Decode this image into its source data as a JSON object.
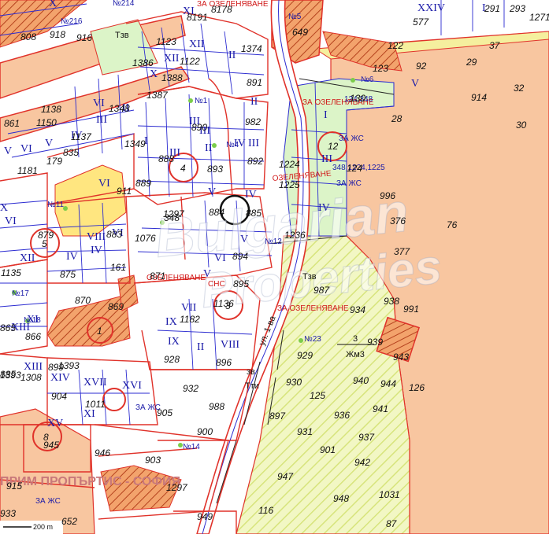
{
  "colors": {
    "orange": "#f8c6a0",
    "orange_dark": "#f3a36c",
    "green": "#dcf4c8",
    "yellow": "#ffe680",
    "road_yellow": "#f5ef9e",
    "parcel_red": "#e0322a",
    "inner_blue": "#2b2bd0",
    "hatch": "#c65a2c"
  },
  "scale_label": "200 m",
  "watermark_top": "Bulgarian",
  "watermark_bottom": "Properties",
  "company_text": "ПРИМ ПРОПЪРТИС - СОФИЯ",
  "zone_labels": [
    {
      "t": "Тзв"
    },
    {
      "t": "Тзв"
    },
    {
      "t": "зв"
    },
    {
      "t": "Тти"
    }
  ],
  "zoning_box": {
    "top": "3",
    "bottom": "Жм3"
  },
  "street_name": "ул. 1-ва",
  "red_notes": [
    {
      "t": "ЗА ОЗЕЛЕНЯВАНЕ"
    },
    {
      "t": "ОЗЕЛЕНЯВАНЕ"
    },
    {
      "t": "ОЗЕЛЕНЯВАНЕ"
    },
    {
      "t": "ЗА ОЗЕЛЕНЯВАНЕ"
    },
    {
      "t": "ЗА ОЗЕЛЕНЯВАНЕ"
    },
    {
      "t": "СНС"
    }
  ],
  "blue_notes": [
    {
      "t": "ЗА ЖС"
    },
    {
      "t": "ЗА ЖС"
    },
    {
      "t": "ЗА ЖС"
    },
    {
      "t": "ЗА ЖС"
    },
    {
      "t": "348,1224,1225"
    },
    {
      "t": "124,348"
    }
  ],
  "circles": [
    {
      "t": "4"
    },
    {
      "t": "5"
    },
    {
      "t": "12"
    },
    {
      "t": "3"
    },
    {
      "t": "8"
    },
    {
      "t": "1"
    }
  ],
  "hashes": [
    {
      "t": "№1"
    },
    {
      "t": "№4"
    },
    {
      "t": "№5"
    },
    {
      "t": "№6"
    },
    {
      "t": "№11"
    },
    {
      "t": "№12"
    },
    {
      "t": "№14"
    },
    {
      "t": "№23"
    },
    {
      "t": "№17"
    },
    {
      "t": "№18"
    },
    {
      "t": "№216"
    },
    {
      "t": "№214"
    }
  ],
  "romans": [
    "X",
    "XI",
    "XII",
    "X",
    "XII",
    "VI",
    "V",
    "IV",
    "III",
    "II",
    "I",
    "III",
    "II",
    "IV",
    "III",
    "III",
    "V",
    "IV",
    "III",
    "II",
    "VI",
    "V",
    "IV",
    "IV",
    "V",
    "VI",
    "XI",
    "VIII",
    "VII",
    "VI",
    "IX",
    "VIII",
    "XIV",
    "XVI",
    "XVII",
    "XV",
    "XIII",
    "XI",
    "I",
    "III",
    "IV",
    "II",
    "VI",
    "V",
    "XIII",
    "XII",
    "X",
    "IX",
    "XXIV",
    "I",
    "V",
    "VI",
    "II"
  ],
  "numbers": [
    "808",
    "918",
    "916",
    "8191",
    "8178",
    "1123",
    "1374",
    "649",
    "291",
    "293",
    "1271",
    "577",
    "123",
    "92",
    "37",
    "29",
    "122",
    "1386",
    "1122",
    "891",
    "1388",
    "1387",
    "1348",
    "1138",
    "1137",
    "1150",
    "890",
    "982",
    "861",
    "1349",
    "835",
    "179",
    "1181",
    "888",
    "893",
    "892",
    "1224",
    "1225",
    "889",
    "911",
    "996",
    "376",
    "76",
    "1297",
    "884",
    "885",
    "1236",
    "377",
    "879",
    "883",
    "1076",
    "894",
    "875",
    "161",
    "895",
    "987",
    "870",
    "869",
    "1136",
    "938",
    "991",
    "865",
    "866",
    "1182",
    "934",
    "939",
    "943",
    "928",
    "896",
    "929",
    "1393",
    "1308",
    "904",
    "1011",
    "932",
    "988",
    "930",
    "940",
    "944",
    "126",
    "125",
    "936",
    "941",
    "945",
    "905",
    "900",
    "897",
    "931",
    "937",
    "946",
    "903",
    "901",
    "942",
    "947",
    "948",
    "1031",
    "87",
    "116",
    "949",
    "652",
    "933",
    "915",
    "914",
    "30",
    "32",
    "28",
    "130",
    "124",
    "348",
    "1297",
    "899",
    "1393",
    "1135",
    "871",
    "885",
    "1183"
  ]
}
